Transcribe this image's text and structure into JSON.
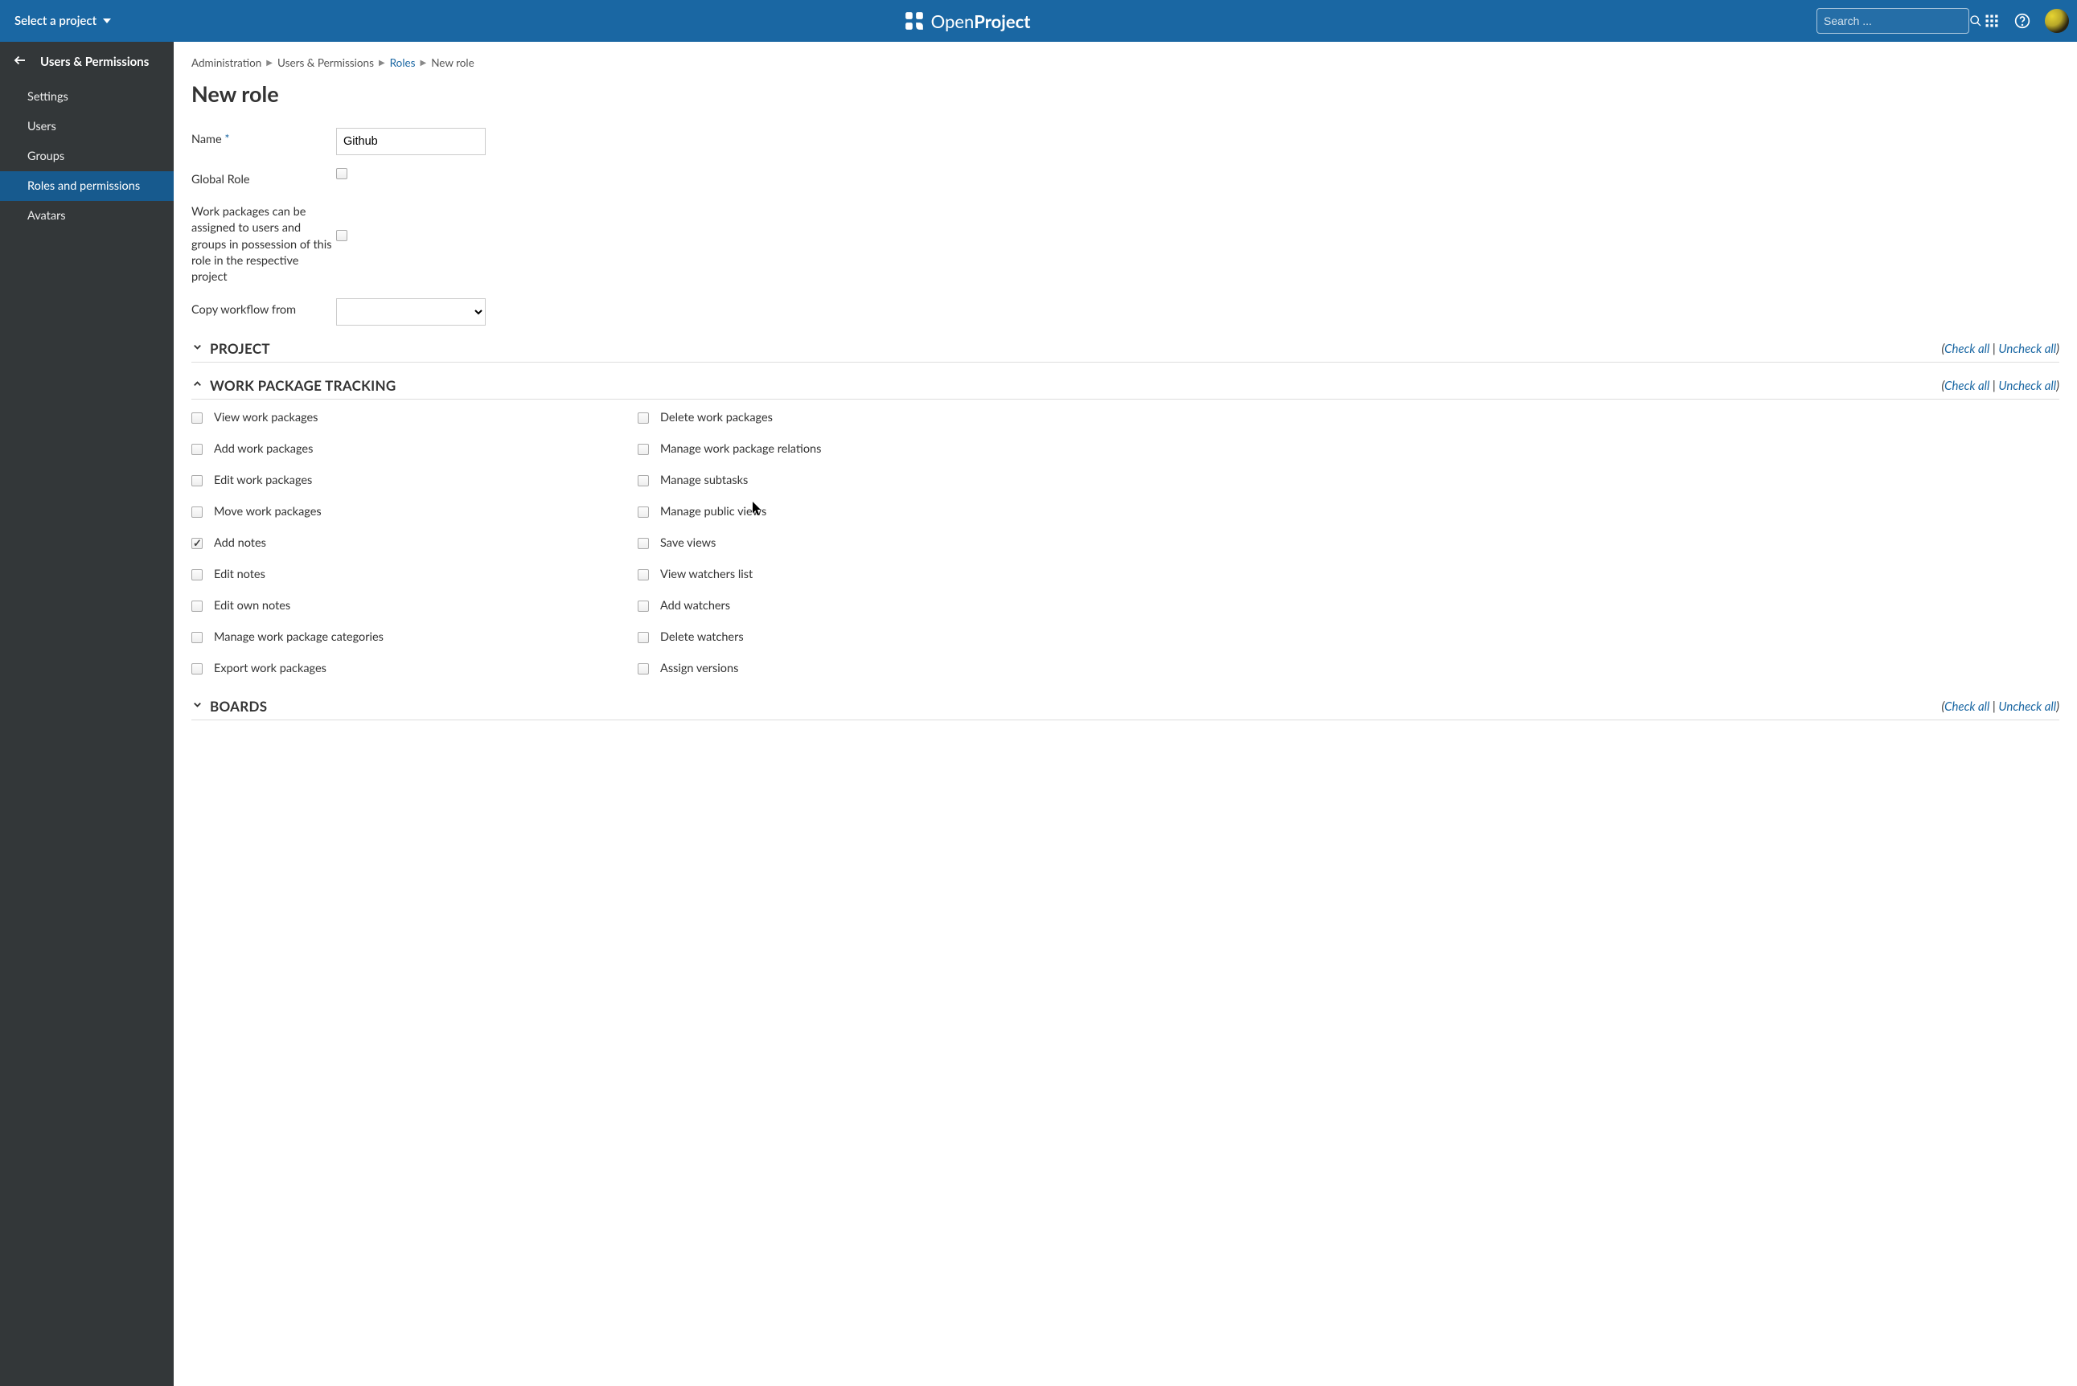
{
  "topbar": {
    "project_selector": "Select a project",
    "logo_text_light": "Open",
    "logo_text_bold": "Project",
    "search_placeholder": "Search ..."
  },
  "sidebar": {
    "title": "Users & Permissions",
    "items": [
      {
        "label": "Settings",
        "active": false
      },
      {
        "label": "Users",
        "active": false
      },
      {
        "label": "Groups",
        "active": false
      },
      {
        "label": "Roles and permissions",
        "active": true
      },
      {
        "label": "Avatars",
        "active": false
      }
    ]
  },
  "breadcrumb": {
    "admin": "Administration",
    "users_perms": "Users & Permissions",
    "roles": "Roles",
    "current": "New role"
  },
  "page": {
    "title": "New role"
  },
  "form": {
    "name_label": "Name",
    "name_value": "Github",
    "global_role_label": "Global Role",
    "assignable_label": "Work packages can be assigned to users and groups in possession of this role in the respective project",
    "copy_workflow_label": "Copy workflow from"
  },
  "check_actions": {
    "check_all": "Check all",
    "uncheck_all": "Uncheck all"
  },
  "sections": {
    "project": {
      "title": "PROJECT",
      "expanded": false
    },
    "wpt": {
      "title": "WORK PACKAGE TRACKING",
      "expanded": true
    },
    "boards": {
      "title": "BOARDS",
      "expanded": false
    }
  },
  "permissions_wpt": [
    {
      "label": "View work packages",
      "checked": false
    },
    {
      "label": "Delete work packages",
      "checked": false
    },
    {
      "label": "Add work packages",
      "checked": false
    },
    {
      "label": "Manage work package relations",
      "checked": false
    },
    {
      "label": "Edit work packages",
      "checked": false
    },
    {
      "label": "Manage subtasks",
      "checked": false
    },
    {
      "label": "Move work packages",
      "checked": false
    },
    {
      "label": "Manage public views",
      "checked": false
    },
    {
      "label": "Add notes",
      "checked": true
    },
    {
      "label": "Save views",
      "checked": false
    },
    {
      "label": "Edit notes",
      "checked": false
    },
    {
      "label": "View watchers list",
      "checked": false
    },
    {
      "label": "Edit own notes",
      "checked": false
    },
    {
      "label": "Add watchers",
      "checked": false
    },
    {
      "label": "Manage work package categories",
      "checked": false
    },
    {
      "label": "Delete watchers",
      "checked": false
    },
    {
      "label": "Export work packages",
      "checked": false
    },
    {
      "label": "Assign versions",
      "checked": false
    }
  ]
}
